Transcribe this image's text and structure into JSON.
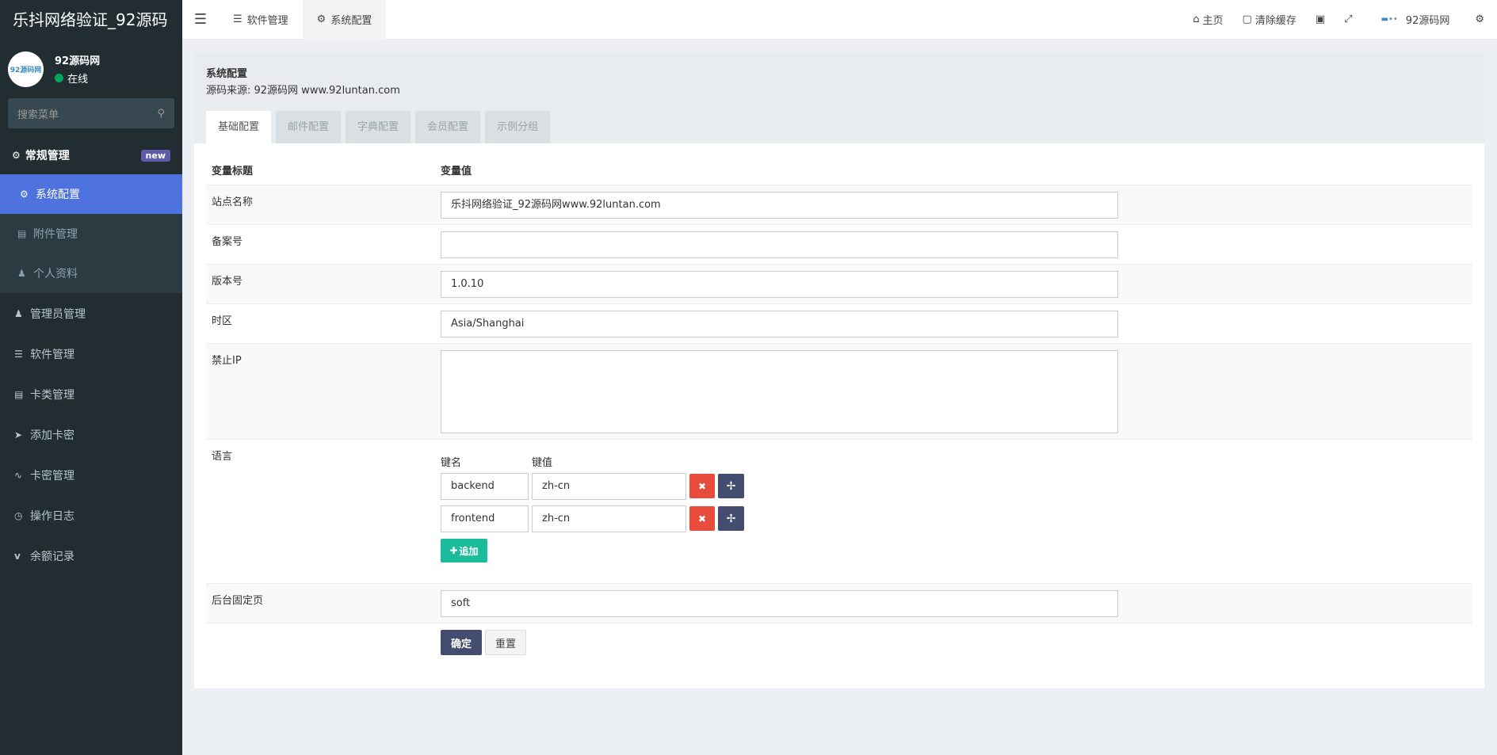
{
  "app": {
    "logo": "乐抖网络验证_92源码",
    "user_name": "92源码网",
    "user_status": "在线",
    "avatar_text": "92源码网",
    "search_placeholder": "搜索菜单"
  },
  "sidebar": {
    "header": {
      "label": "常规管理",
      "badge": "new"
    },
    "submenu": [
      {
        "label": "系统配置",
        "icon": "gear-icon",
        "active": true
      },
      {
        "label": "附件管理",
        "icon": "image-icon"
      },
      {
        "label": "个人资料",
        "icon": "user-icon"
      }
    ],
    "items": [
      {
        "label": "管理员管理",
        "icon": "user-icon"
      },
      {
        "label": "软件管理",
        "icon": "list-icon"
      },
      {
        "label": "卡类管理",
        "icon": "card-list-icon"
      },
      {
        "label": "添加卡密",
        "icon": "paper-plane-icon"
      },
      {
        "label": "卡密管理",
        "icon": "rss-icon"
      },
      {
        "label": "操作日志",
        "icon": "clock-icon"
      },
      {
        "label": "余额记录",
        "icon": "vimeo-icon"
      }
    ]
  },
  "topbar": {
    "tabs": [
      {
        "label": "软件管理",
        "icon": "list-icon"
      },
      {
        "label": "系统配置",
        "icon": "gear-icon",
        "active": true
      }
    ],
    "right": {
      "home": "主页",
      "clear_cache": "清除缓存",
      "user": "92源码网"
    }
  },
  "content": {
    "title": "系统配置",
    "subtitle": "源码来源: 92源码网 www.92luntan.com",
    "tabs": [
      "基础配置",
      "邮件配置",
      "字典配置",
      "会员配置",
      "示例分组"
    ],
    "table_headers": {
      "col1": "变量标题",
      "col2": "变量值"
    },
    "fields": {
      "site_name": {
        "label": "站点名称",
        "value": "乐抖网络验证_92源码网www.92luntan.com"
      },
      "beian": {
        "label": "备案号",
        "value": ""
      },
      "version": {
        "label": "版本号",
        "value": "1.0.10"
      },
      "timezone": {
        "label": "时区",
        "value": "Asia/Shanghai"
      },
      "forbidden_ip": {
        "label": "禁止IP",
        "value": ""
      },
      "language": {
        "label": "语言",
        "key_header": "键名",
        "value_header": "键值",
        "rows": [
          {
            "key": "backend",
            "value": "zh-cn"
          },
          {
            "key": "frontend",
            "value": "zh-cn"
          }
        ],
        "add_label": "追加"
      },
      "fixed_page": {
        "label": "后台固定页",
        "value": "soft"
      }
    },
    "buttons": {
      "ok": "确定",
      "reset": "重置"
    }
  }
}
